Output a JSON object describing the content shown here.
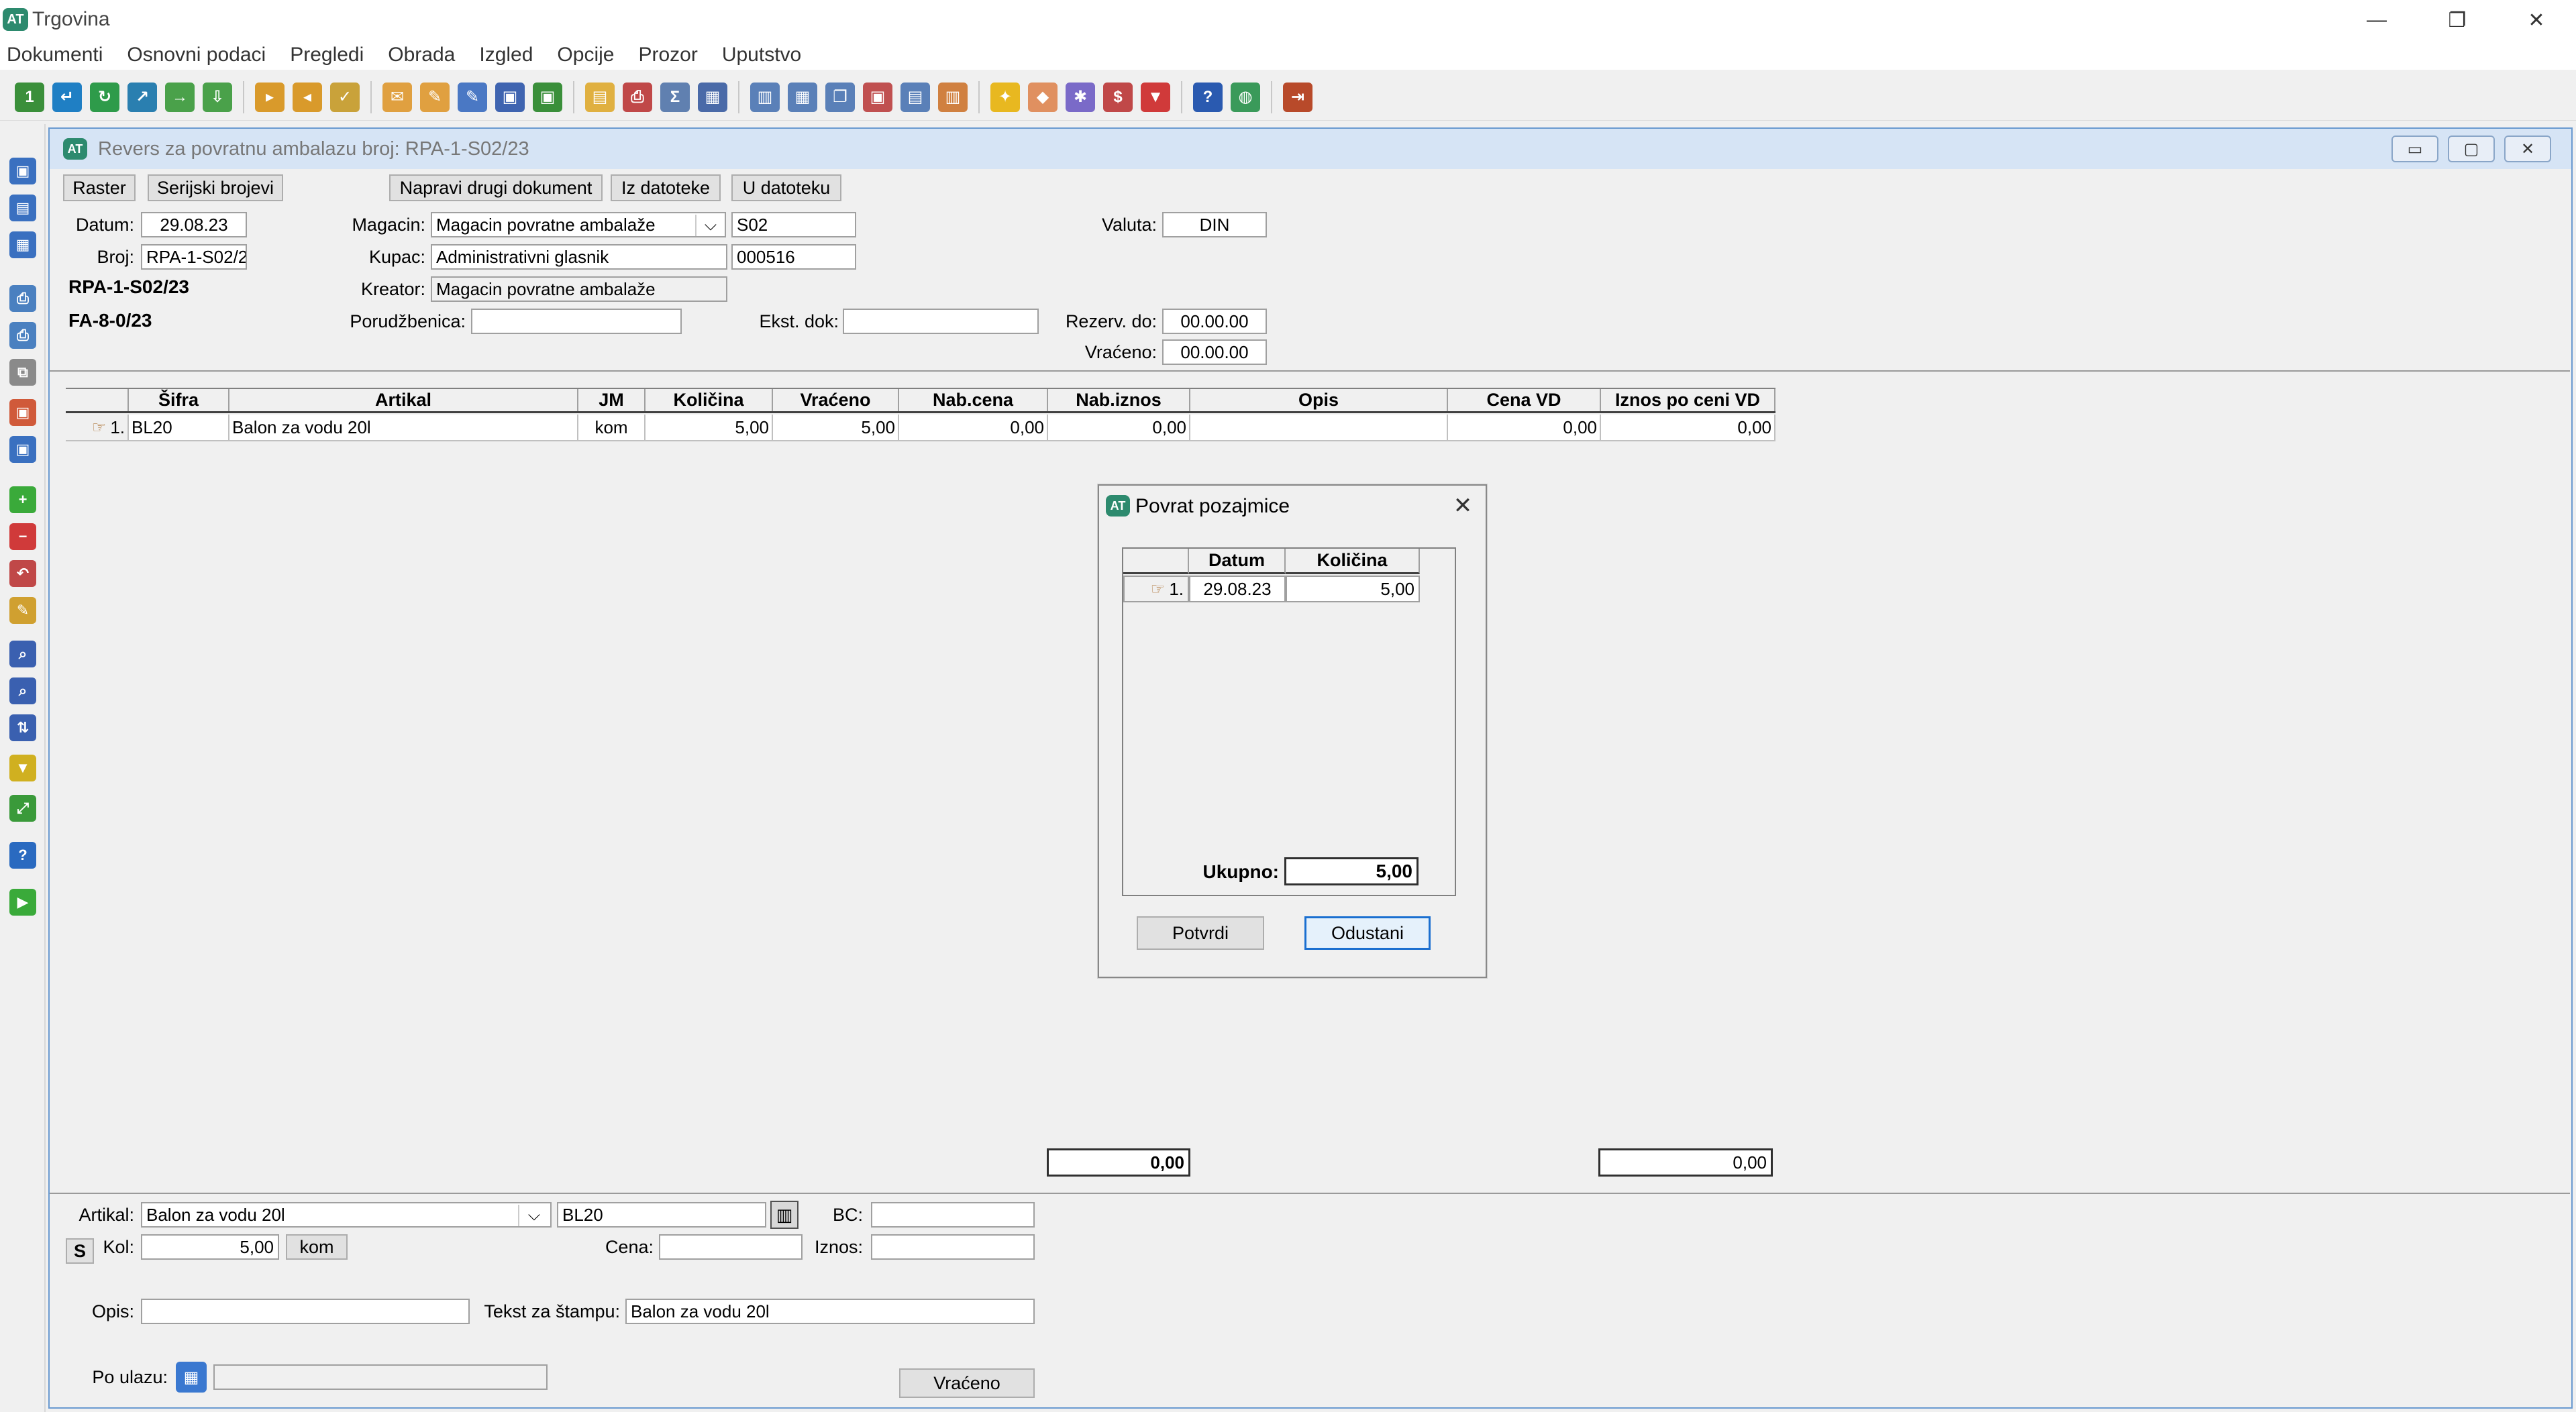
{
  "window": {
    "title": "Trgovina",
    "logo": "AT"
  },
  "window_controls": {
    "minimize": "—",
    "restore": "❐",
    "close": "✕"
  },
  "menu": [
    "Dokumenti",
    "Osnovni podaci",
    "Pregledi",
    "Obrada",
    "Izgled",
    "Opcije",
    "Prozor",
    "Uputstvo"
  ],
  "toolbar_icons": [
    {
      "name": "new-document-icon",
      "color": "#3a8f3a",
      "glyph": "1"
    },
    {
      "name": "import-icon",
      "color": "#1f7fc4",
      "glyph": "↵"
    },
    {
      "name": "refresh-icon",
      "color": "#2e9b4a",
      "glyph": "↻"
    },
    {
      "name": "export-icon",
      "color": "#2a7fb0",
      "glyph": "↗"
    },
    {
      "name": "forward-icon",
      "color": "#4aa14a",
      "glyph": "→"
    },
    {
      "name": "download-icon",
      "color": "#4aa14a",
      "glyph": "⇩"
    },
    {
      "name": "sep"
    },
    {
      "name": "folder-in-icon",
      "color": "#d99a2b",
      "glyph": "▸"
    },
    {
      "name": "folder-out-icon",
      "color": "#d99a2b",
      "glyph": "◂"
    },
    {
      "name": "folder-check-icon",
      "color": "#c9a23a",
      "glyph": "✓"
    },
    {
      "name": "sep"
    },
    {
      "name": "mail-icon",
      "color": "#e0a040",
      "glyph": "✉"
    },
    {
      "name": "edit-doc-icon",
      "color": "#e0a040",
      "glyph": "✎"
    },
    {
      "name": "edit-doc-blue-icon",
      "color": "#4a78c4",
      "glyph": "✎"
    },
    {
      "name": "save-blue-icon",
      "color": "#3f64b0",
      "glyph": "▣"
    },
    {
      "name": "save-green-icon",
      "color": "#3a8f3a",
      "glyph": "▣"
    },
    {
      "name": "sep"
    },
    {
      "name": "document-icon",
      "color": "#e0b040",
      "glyph": "▤"
    },
    {
      "name": "print-icon",
      "color": "#c04848",
      "glyph": "⎙"
    },
    {
      "name": "sum-icon",
      "color": "#6080b0",
      "glyph": "Σ"
    },
    {
      "name": "table-icon",
      "color": "#4a6aa8",
      "glyph": "▦"
    },
    {
      "name": "sep"
    },
    {
      "name": "layout-columns-icon",
      "color": "#5a80b8",
      "glyph": "▥"
    },
    {
      "name": "layout-grid-icon",
      "color": "#5a80b8",
      "glyph": "▦"
    },
    {
      "name": "windows-icon",
      "color": "#5a80b8",
      "glyph": "❐"
    },
    {
      "name": "window-close-icon",
      "color": "#c05050",
      "glyph": "▣"
    },
    {
      "name": "window-list-icon",
      "color": "#5a80b8",
      "glyph": "▤"
    },
    {
      "name": "window-tile-icon",
      "color": "#d08040",
      "glyph": "▥"
    },
    {
      "name": "sep"
    },
    {
      "name": "lightbulb-icon",
      "color": "#e8b820",
      "glyph": "✦"
    },
    {
      "name": "tag-icon",
      "color": "#e09060",
      "glyph": "◆"
    },
    {
      "name": "gear-icon",
      "color": "#7a6ac8",
      "glyph": "✱"
    },
    {
      "name": "report-icon",
      "color": "#c04848",
      "glyph": "$"
    },
    {
      "name": "gem-icon",
      "color": "#d03a3a",
      "glyph": "▼"
    },
    {
      "name": "sep"
    },
    {
      "name": "help-icon",
      "color": "#2a5ab0",
      "glyph": "?"
    },
    {
      "name": "globe-icon",
      "color": "#3a9a5a",
      "glyph": "◍"
    },
    {
      "name": "sep"
    },
    {
      "name": "exit-icon",
      "color": "#b84a2a",
      "glyph": "⇥"
    }
  ],
  "left_rail_icons": [
    {
      "name": "save-icon",
      "color": "#3a70c0",
      "glyph": "▣",
      "top": 0
    },
    {
      "name": "save-as-icon",
      "color": "#3a70c0",
      "glyph": "▤",
      "top": 0
    },
    {
      "name": "table-view-icon",
      "color": "#3a70c0",
      "glyph": "▦",
      "top": 0
    },
    {
      "name": "printer-icon",
      "color": "#4a80c0",
      "glyph": "⎙",
      "top": 0
    },
    {
      "name": "print-preview-icon",
      "color": "#4a80c0",
      "glyph": "⎙",
      "top": 0
    },
    {
      "name": "copy-icon",
      "color": "#8a8a8a",
      "glyph": "⧉",
      "top": 0
    },
    {
      "name": "package-out-icon",
      "color": "#d05a3a",
      "glyph": "▣",
      "top": 0
    },
    {
      "name": "package-in-icon",
      "color": "#3a70c0",
      "glyph": "▣",
      "top": 0
    },
    {
      "name": "add-icon",
      "color": "#3aaa3a",
      "glyph": "+",
      "top": 0
    },
    {
      "name": "remove-icon",
      "color": "#d03a3a",
      "glyph": "−",
      "top": 0
    },
    {
      "name": "undo-icon",
      "color": "#c04848",
      "glyph": "↶",
      "top": 0
    },
    {
      "name": "edit-icon",
      "color": "#d0a030",
      "glyph": "✎",
      "top": 0
    },
    {
      "name": "find-icon",
      "color": "#3a60b0",
      "glyph": "⌕",
      "top": 0
    },
    {
      "name": "find-replace-icon",
      "color": "#3a60b0",
      "glyph": "⌕",
      "top": 0
    },
    {
      "name": "sort-icon",
      "color": "#3a60b0",
      "glyph": "⇅",
      "top": 0
    },
    {
      "name": "filter-icon",
      "color": "#d0b020",
      "glyph": "▼",
      "top": 0
    },
    {
      "name": "expand-icon",
      "color": "#3a9a3a",
      "glyph": "⤢",
      "top": 0
    },
    {
      "name": "help-round-icon",
      "color": "#2a6ac0",
      "glyph": "?",
      "top": 0
    },
    {
      "name": "go-icon",
      "color": "#3aaa3a",
      "glyph": "▶",
      "top": 0
    }
  ],
  "child_window": {
    "title": "Revers za povratnu ambalazu broj: RPA-1-S02/23",
    "logo": "AT",
    "controls": {
      "minimize": "▭",
      "maximize": "▢",
      "close": "✕"
    }
  },
  "buttons": {
    "raster": "Raster",
    "serijski": "Serijski brojevi",
    "napravi": "Napravi drugi dokument",
    "iz_datoteke": "Iz datoteke",
    "u_datoteku": "U datoteku"
  },
  "header_form": {
    "datum_label": "Datum:",
    "datum": "29.08.23",
    "broj_label": "Broj:",
    "broj": "RPA-1-S02/2",
    "doc_number": "RPA-1-S02/23",
    "fa_number": "FA-8-0/23",
    "magacin_label": "Magacin:",
    "magacin": "Magacin povratne ambalaže",
    "magacin_code": "S02",
    "kupac_label": "Kupac:",
    "kupac": "Administrativni glasnik",
    "kupac_code": "000516",
    "kreator_label": "Kreator:",
    "kreator": "Magacin povratne ambalaže",
    "porudzbenica_label": "Porudžbenica:",
    "porudzbenica": "",
    "ekst_dok_label": "Ekst. dok:",
    "ekst_dok": "",
    "valuta_label": "Valuta:",
    "valuta": "DIN",
    "rezerv_label": "Rezerv. do:",
    "rezerv": "00.00.00",
    "vraceno_label": "Vraćeno:",
    "vraceno": "00.00.00"
  },
  "grid": {
    "columns": [
      "Šifra",
      "Artikal",
      "JM",
      "Količina",
      "Vraćeno",
      "Nab.cena",
      "Nab.iznos",
      "Opis",
      "Cena VD",
      "Iznos po ceni VD"
    ],
    "rows": [
      {
        "index": "1.",
        "sifra": "BL20",
        "artikal": "Balon za vodu 20l",
        "jm": "kom",
        "kolicina": "5,00",
        "vraceno": "5,00",
        "nab_cena": "0,00",
        "nab_iznos": "0,00",
        "opis": "",
        "cena_vd": "0,00",
        "iznos_vd": "0,00"
      }
    ],
    "totals": {
      "nab_iznos": "0,00",
      "iznos_vd": "0,00"
    }
  },
  "bottom_form": {
    "artikal_label": "Artikal:",
    "artikal": "Balon za vodu 20l",
    "artikal_code": "BL20",
    "bc_label": "BC:",
    "bc": "",
    "s_button": "S",
    "kol_label": "Kol:",
    "kol": "5,00",
    "jm_button": "kom",
    "cena_label": "Cena:",
    "cena": "",
    "iznos_label": "Iznos:",
    "iznos": "",
    "opis_label": "Opis:",
    "opis": "",
    "tekst_label": "Tekst za štampu:",
    "tekst": "Balon za vodu 20l",
    "po_ulazu_label": "Po ulazu:",
    "po_ulazu": "",
    "vraceno_button": "Vraćeno"
  },
  "dialog": {
    "title": "Povrat pozajmice",
    "logo": "AT",
    "close": "✕",
    "columns": [
      "Datum",
      "Količina"
    ],
    "rows": [
      {
        "index": "1.",
        "datum": "29.08.23",
        "kolicina": "5,00"
      }
    ],
    "ukupno_label": "Ukupno:",
    "ukupno": "5,00",
    "potvrdi": "Potvrdi",
    "odustani": "Odustani"
  }
}
